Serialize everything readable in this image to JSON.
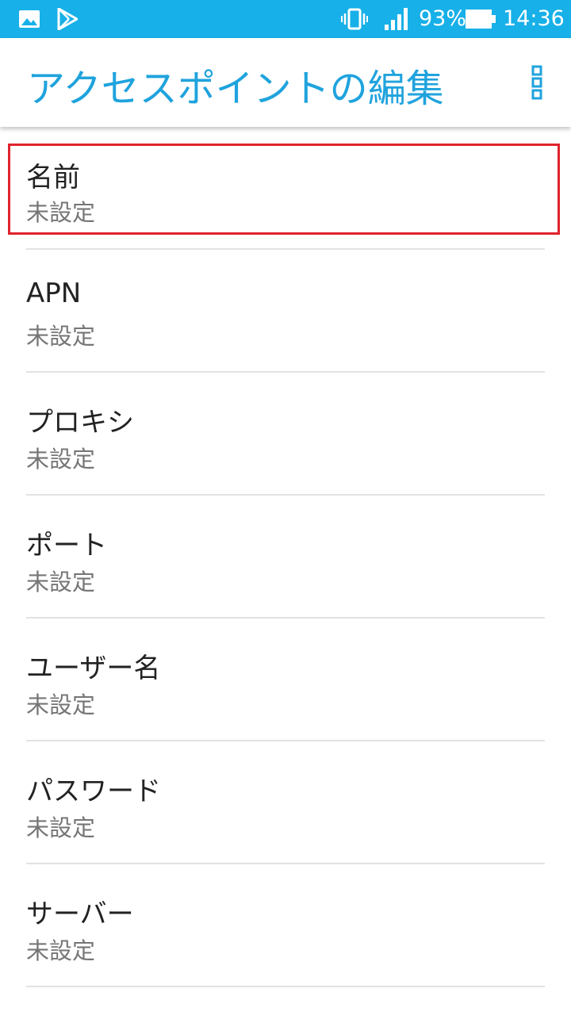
{
  "status_bar": {
    "icons_left": [
      "image-icon",
      "play-store-icon"
    ],
    "icons_right": [
      "vibrate-icon",
      "signal-icon",
      "battery-icon"
    ],
    "battery_percent": "93%",
    "time": "14:36",
    "background_color": "#17b0e8"
  },
  "app_bar": {
    "title": "アクセスポイントの編集",
    "title_color": "#1fa3dd",
    "menu_icon": "overflow-menu-icon"
  },
  "preferences": [
    {
      "title": "名前",
      "summary": "未設定",
      "highlighted": true
    },
    {
      "title": "APN",
      "summary": "未設定"
    },
    {
      "title": "プロキシ",
      "summary": "未設定"
    },
    {
      "title": "ポート",
      "summary": "未設定"
    },
    {
      "title": "ユーザー名",
      "summary": "未設定"
    },
    {
      "title": "パスワード",
      "summary": "未設定"
    },
    {
      "title": "サーバー",
      "summary": "未設定"
    }
  ],
  "highlight_color": "#e0232d"
}
